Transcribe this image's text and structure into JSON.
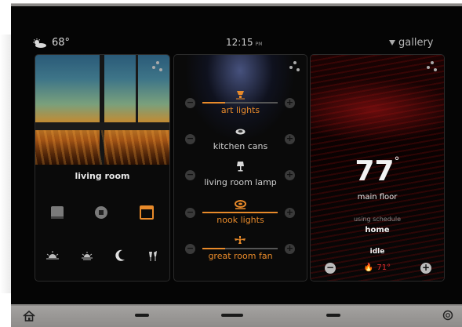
{
  "status": {
    "weather_icon": "partly-cloudy-icon",
    "temperature": "68°",
    "time": "12:15",
    "ampm": "PM",
    "gallery_label": "gallery"
  },
  "living_room": {
    "label": "living room",
    "blind_controls": [
      "blind-close-icon",
      "blind-stop-icon",
      "blind-open-icon"
    ],
    "scene_icons": [
      "sunrise-icon",
      "sunset-icon",
      "moon-icon",
      "party-icon"
    ]
  },
  "lights": [
    {
      "name": "art lights",
      "icon": "spotlight-icon",
      "level": 0.3,
      "active": true
    },
    {
      "name": "kitchen cans",
      "icon": "downlight-icon",
      "level": 0,
      "active": false
    },
    {
      "name": "living room lamp",
      "icon": "lamp-icon",
      "level": 0,
      "active": false
    },
    {
      "name": "nook lights",
      "icon": "pendant-icon",
      "level": 1.0,
      "active": true
    },
    {
      "name": "great room fan",
      "icon": "fan-icon",
      "level": 0.3,
      "active": true
    }
  ],
  "thermostat": {
    "temperature": "77",
    "degree": "°",
    "zone": "main floor",
    "schedule_label": "using schedule",
    "schedule_name": "home",
    "mode": "idle",
    "setpoint": "71°",
    "heat_color": "#e03030"
  },
  "colors": {
    "accent": "#e88a2a",
    "inactive_label": "#d0d0d0"
  },
  "bottom_bar": {
    "home_icon": "home-icon",
    "power_icon": "power-icon",
    "pages": 3
  }
}
